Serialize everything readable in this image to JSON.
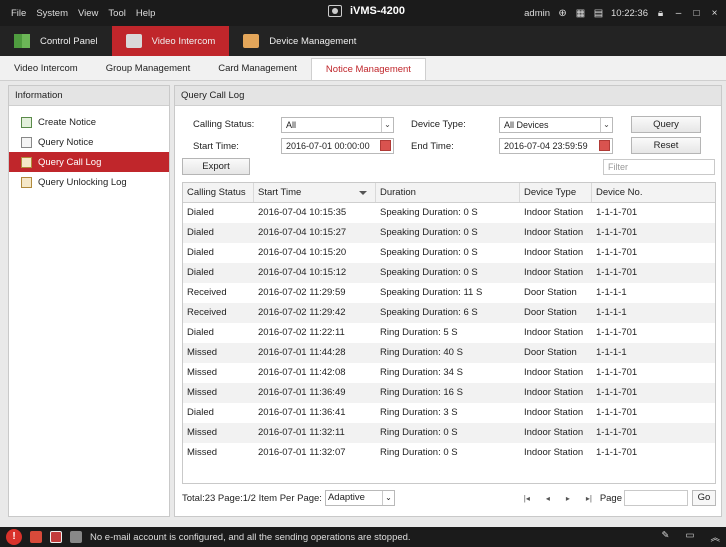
{
  "titlebar": {
    "menu": [
      "File",
      "System",
      "View",
      "Tool",
      "Help"
    ],
    "app_title": "iVMS-4200",
    "user": "admin",
    "time": "10:22:36",
    "icons": [
      "globe-icon",
      "keyboard-icon",
      "calendar-icon",
      "lock-icon",
      "minimize-icon",
      "maximize-icon",
      "close-icon"
    ]
  },
  "modules": [
    {
      "label": "Control Panel",
      "icon": "control-panel-icon"
    },
    {
      "label": "Video Intercom",
      "icon": "video-intercom-icon"
    },
    {
      "label": "Device Management",
      "icon": "device-management-icon"
    }
  ],
  "subtabs": [
    "Video Intercom",
    "Group Management",
    "Card Management",
    "Notice Management"
  ],
  "sidebar": {
    "title": "Information",
    "items": [
      {
        "label": "Create Notice"
      },
      {
        "label": "Query Notice"
      },
      {
        "label": "Query Call Log"
      },
      {
        "label": "Query Unlocking Log"
      }
    ]
  },
  "main": {
    "title": "Query Call Log",
    "calling_status_label": "Calling Status:",
    "calling_status_value": "All",
    "device_type_label": "Device Type:",
    "device_type_value": "All Devices",
    "start_time_label": "Start Time:",
    "start_time_value": "2016-07-01 00:00:00",
    "end_time_label": "End Time:",
    "end_time_value": "2016-07-04 23:59:59",
    "query_button": "Query",
    "reset_button": "Reset",
    "export_button": "Export",
    "filter_placeholder": "Filter"
  },
  "table": {
    "headers": [
      "Calling Status",
      "Start Time",
      "Duration",
      "Device Type",
      "Device No."
    ],
    "rows": [
      [
        "Dialed",
        "2016-07-04 10:15:35",
        "Speaking Duration: 0 S",
        "Indoor Station",
        "1-1-1-701"
      ],
      [
        "Dialed",
        "2016-07-04 10:15:27",
        "Speaking Duration: 0 S",
        "Indoor Station",
        "1-1-1-701"
      ],
      [
        "Dialed",
        "2016-07-04 10:15:20",
        "Speaking Duration: 0 S",
        "Indoor Station",
        "1-1-1-701"
      ],
      [
        "Dialed",
        "2016-07-04 10:15:12",
        "Speaking Duration: 0 S",
        "Indoor Station",
        "1-1-1-701"
      ],
      [
        "Received",
        "2016-07-02 11:29:59",
        "Speaking Duration: 11 S",
        "Door Station",
        "1-1-1-1"
      ],
      [
        "Received",
        "2016-07-02 11:29:42",
        "Speaking Duration: 6 S",
        "Door Station",
        "1-1-1-1"
      ],
      [
        "Dialed",
        "2016-07-02 11:22:11",
        "Ring Duration: 5 S",
        "Indoor Station",
        "1-1-1-701"
      ],
      [
        "Missed",
        "2016-07-01 11:44:28",
        "Ring Duration: 40 S",
        "Door Station",
        "1-1-1-1"
      ],
      [
        "Missed",
        "2016-07-01 11:42:08",
        "Ring Duration: 34 S",
        "Indoor Station",
        "1-1-1-701"
      ],
      [
        "Missed",
        "2016-07-01 11:36:49",
        "Ring Duration: 16 S",
        "Indoor Station",
        "1-1-1-701"
      ],
      [
        "Dialed",
        "2016-07-01 11:36:41",
        "Ring Duration: 3 S",
        "Indoor Station",
        "1-1-1-701"
      ],
      [
        "Missed",
        "2016-07-01 11:32:11",
        "Ring Duration: 0 S",
        "Indoor Station",
        "1-1-1-701"
      ],
      [
        "Missed",
        "2016-07-01 11:32:07",
        "Ring Duration: 0 S",
        "Indoor Station",
        "1-1-1-701"
      ]
    ]
  },
  "pager": {
    "summary": "Total:23  Page:1/2  Item Per Page:",
    "per_page": "Adaptive",
    "page_label": "Page",
    "go_label": "Go"
  },
  "statusbar": {
    "message": "No e-mail account is configured, and all the sending operations are stopped."
  }
}
